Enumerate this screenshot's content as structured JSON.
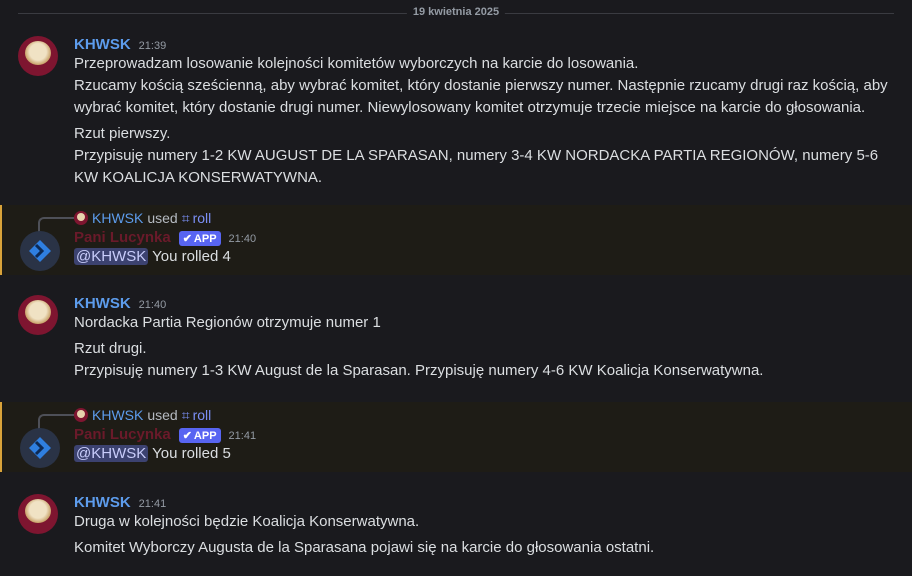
{
  "date_divider": "19 kwietnia 2025",
  "messages": [
    {
      "author": "KHWSK",
      "time": "21:39",
      "lines": [
        "Przeprowadzam losowanie kolejności komitetów wyborczych na karcie do losowania.",
        "Rzucamy kością sześcienną, aby wybrać komitet, który dostanie pierwszy numer. Następnie rzucamy drugi raz kością, aby wybrać komitet, który dostanie drugi numer. Niewylosowany komitet otrzymuje trzecie miejsce na karcie do głosowania.",
        "Rzut pierwszy.",
        "Przypisuję numery 1-2 KW AUGUST DE LA SPARASAN, numery 3-4 KW NORDACKA PARTIA REGIONÓW, numery 5-6 KW KOALICJA KONSERWATYWNA."
      ]
    },
    {
      "author": "KHWSK",
      "time": "21:40",
      "lines": [
        "Nordacka Partia Regionów otrzymuje numer 1",
        "Rzut drugi.",
        "Przypisuję numery 1-3 KW August de la Sparasan. Przypisuję numery 4-6 KW Koalicja Konserwatywna."
      ]
    },
    {
      "author": "KHWSK",
      "time": "21:41",
      "lines": [
        "Druga w kolejności będzie Koalicja Konserwatywna.",
        "Komitet Wyborczy Augusta de la Sparasana pojawi się na karcie do głosowania ostatni."
      ]
    }
  ],
  "rolls": [
    {
      "user": "KHWSK",
      "used": "used",
      "command": "roll",
      "bot_name": "Pani Lucynka",
      "app_badge": "APP",
      "time": "21:40",
      "mention": "@KHWSK",
      "result": "You rolled 4"
    },
    {
      "user": "KHWSK",
      "used": "used",
      "command": "roll",
      "bot_name": "Pani Lucynka",
      "app_badge": "APP",
      "time": "21:41",
      "mention": "@KHWSK",
      "result": "You rolled 5"
    }
  ],
  "colors": {
    "author": "#5d9cec",
    "app_badge": "#5865f2",
    "accent_bar": "#d9a33a"
  }
}
